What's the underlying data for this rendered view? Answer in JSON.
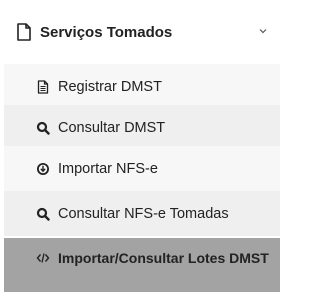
{
  "menu": {
    "header": {
      "title": "Serviços Tomados",
      "icon": "document-icon",
      "toggle_icon": "chevron-down-icon"
    },
    "items": [
      {
        "label": "Registrar DMST",
        "icon": "file-text-icon"
      },
      {
        "label": "Consultar DMST",
        "icon": "search-icon"
      },
      {
        "label": "Importar NFS-e",
        "icon": "import-circle-icon"
      },
      {
        "label": "Consultar NFS-e Tomadas",
        "icon": "search-icon"
      },
      {
        "label": "Importar/Consultar Lotes DMST",
        "icon": "code-icon",
        "active": true
      }
    ]
  },
  "colors": {
    "active_bg": "#a3a3a3",
    "item_bg": "#f7f7f7",
    "item_alt_bg": "#efefef"
  }
}
